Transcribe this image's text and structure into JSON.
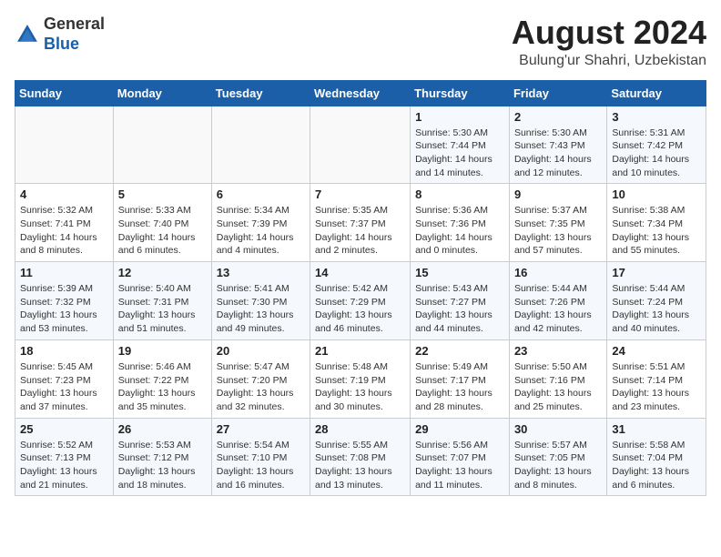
{
  "header": {
    "logo_general": "General",
    "logo_blue": "Blue",
    "month_year": "August 2024",
    "location": "Bulung'ur Shahri, Uzbekistan"
  },
  "days_of_week": [
    "Sunday",
    "Monday",
    "Tuesday",
    "Wednesday",
    "Thursday",
    "Friday",
    "Saturday"
  ],
  "weeks": [
    [
      {
        "day": "",
        "info": ""
      },
      {
        "day": "",
        "info": ""
      },
      {
        "day": "",
        "info": ""
      },
      {
        "day": "",
        "info": ""
      },
      {
        "day": "1",
        "info": "Sunrise: 5:30 AM\nSunset: 7:44 PM\nDaylight: 14 hours\nand 14 minutes."
      },
      {
        "day": "2",
        "info": "Sunrise: 5:30 AM\nSunset: 7:43 PM\nDaylight: 14 hours\nand 12 minutes."
      },
      {
        "day": "3",
        "info": "Sunrise: 5:31 AM\nSunset: 7:42 PM\nDaylight: 14 hours\nand 10 minutes."
      }
    ],
    [
      {
        "day": "4",
        "info": "Sunrise: 5:32 AM\nSunset: 7:41 PM\nDaylight: 14 hours\nand 8 minutes."
      },
      {
        "day": "5",
        "info": "Sunrise: 5:33 AM\nSunset: 7:40 PM\nDaylight: 14 hours\nand 6 minutes."
      },
      {
        "day": "6",
        "info": "Sunrise: 5:34 AM\nSunset: 7:39 PM\nDaylight: 14 hours\nand 4 minutes."
      },
      {
        "day": "7",
        "info": "Sunrise: 5:35 AM\nSunset: 7:37 PM\nDaylight: 14 hours\nand 2 minutes."
      },
      {
        "day": "8",
        "info": "Sunrise: 5:36 AM\nSunset: 7:36 PM\nDaylight: 14 hours\nand 0 minutes."
      },
      {
        "day": "9",
        "info": "Sunrise: 5:37 AM\nSunset: 7:35 PM\nDaylight: 13 hours\nand 57 minutes."
      },
      {
        "day": "10",
        "info": "Sunrise: 5:38 AM\nSunset: 7:34 PM\nDaylight: 13 hours\nand 55 minutes."
      }
    ],
    [
      {
        "day": "11",
        "info": "Sunrise: 5:39 AM\nSunset: 7:32 PM\nDaylight: 13 hours\nand 53 minutes."
      },
      {
        "day": "12",
        "info": "Sunrise: 5:40 AM\nSunset: 7:31 PM\nDaylight: 13 hours\nand 51 minutes."
      },
      {
        "day": "13",
        "info": "Sunrise: 5:41 AM\nSunset: 7:30 PM\nDaylight: 13 hours\nand 49 minutes."
      },
      {
        "day": "14",
        "info": "Sunrise: 5:42 AM\nSunset: 7:29 PM\nDaylight: 13 hours\nand 46 minutes."
      },
      {
        "day": "15",
        "info": "Sunrise: 5:43 AM\nSunset: 7:27 PM\nDaylight: 13 hours\nand 44 minutes."
      },
      {
        "day": "16",
        "info": "Sunrise: 5:44 AM\nSunset: 7:26 PM\nDaylight: 13 hours\nand 42 minutes."
      },
      {
        "day": "17",
        "info": "Sunrise: 5:44 AM\nSunset: 7:24 PM\nDaylight: 13 hours\nand 40 minutes."
      }
    ],
    [
      {
        "day": "18",
        "info": "Sunrise: 5:45 AM\nSunset: 7:23 PM\nDaylight: 13 hours\nand 37 minutes."
      },
      {
        "day": "19",
        "info": "Sunrise: 5:46 AM\nSunset: 7:22 PM\nDaylight: 13 hours\nand 35 minutes."
      },
      {
        "day": "20",
        "info": "Sunrise: 5:47 AM\nSunset: 7:20 PM\nDaylight: 13 hours\nand 32 minutes."
      },
      {
        "day": "21",
        "info": "Sunrise: 5:48 AM\nSunset: 7:19 PM\nDaylight: 13 hours\nand 30 minutes."
      },
      {
        "day": "22",
        "info": "Sunrise: 5:49 AM\nSunset: 7:17 PM\nDaylight: 13 hours\nand 28 minutes."
      },
      {
        "day": "23",
        "info": "Sunrise: 5:50 AM\nSunset: 7:16 PM\nDaylight: 13 hours\nand 25 minutes."
      },
      {
        "day": "24",
        "info": "Sunrise: 5:51 AM\nSunset: 7:14 PM\nDaylight: 13 hours\nand 23 minutes."
      }
    ],
    [
      {
        "day": "25",
        "info": "Sunrise: 5:52 AM\nSunset: 7:13 PM\nDaylight: 13 hours\nand 21 minutes."
      },
      {
        "day": "26",
        "info": "Sunrise: 5:53 AM\nSunset: 7:12 PM\nDaylight: 13 hours\nand 18 minutes."
      },
      {
        "day": "27",
        "info": "Sunrise: 5:54 AM\nSunset: 7:10 PM\nDaylight: 13 hours\nand 16 minutes."
      },
      {
        "day": "28",
        "info": "Sunrise: 5:55 AM\nSunset: 7:08 PM\nDaylight: 13 hours\nand 13 minutes."
      },
      {
        "day": "29",
        "info": "Sunrise: 5:56 AM\nSunset: 7:07 PM\nDaylight: 13 hours\nand 11 minutes."
      },
      {
        "day": "30",
        "info": "Sunrise: 5:57 AM\nSunset: 7:05 PM\nDaylight: 13 hours\nand 8 minutes."
      },
      {
        "day": "31",
        "info": "Sunrise: 5:58 AM\nSunset: 7:04 PM\nDaylight: 13 hours\nand 6 minutes."
      }
    ]
  ]
}
